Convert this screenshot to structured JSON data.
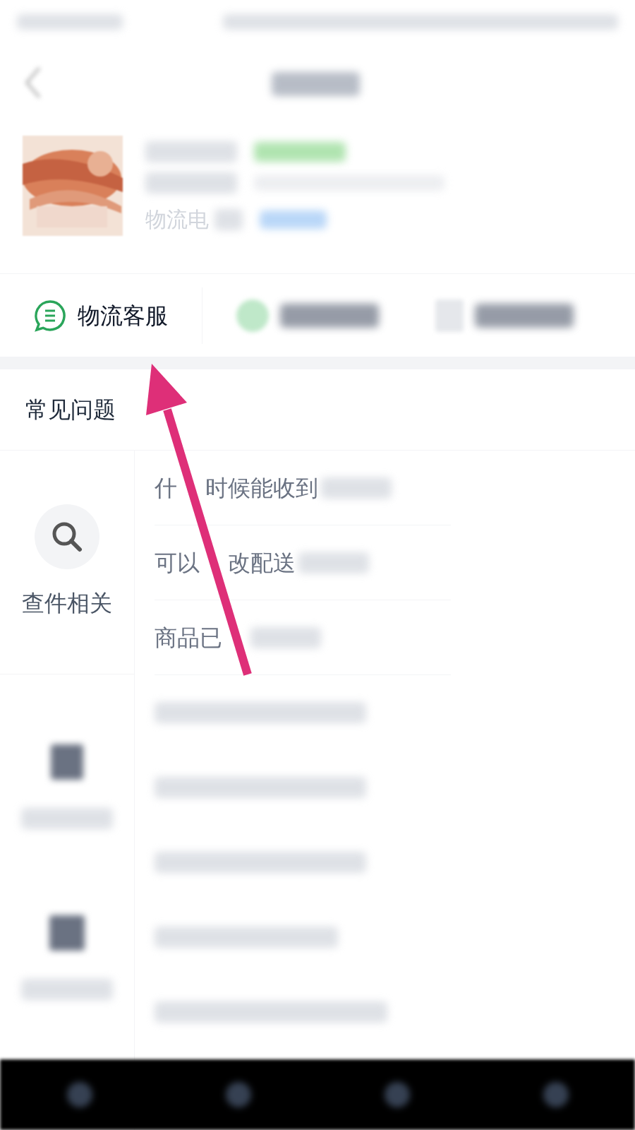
{
  "info_rows": [
    {
      "label": "物流电"
    }
  ],
  "service_tabs": [
    {
      "label": "物流客服"
    }
  ],
  "faq_title": "常见问题",
  "categories": [
    {
      "label": "查件相关"
    }
  ],
  "questions": [
    {
      "parts": [
        "什",
        "时候能收到"
      ]
    },
    {
      "parts": [
        "可以",
        "改配送"
      ]
    },
    {
      "parts": [
        "商品已"
      ]
    }
  ]
}
